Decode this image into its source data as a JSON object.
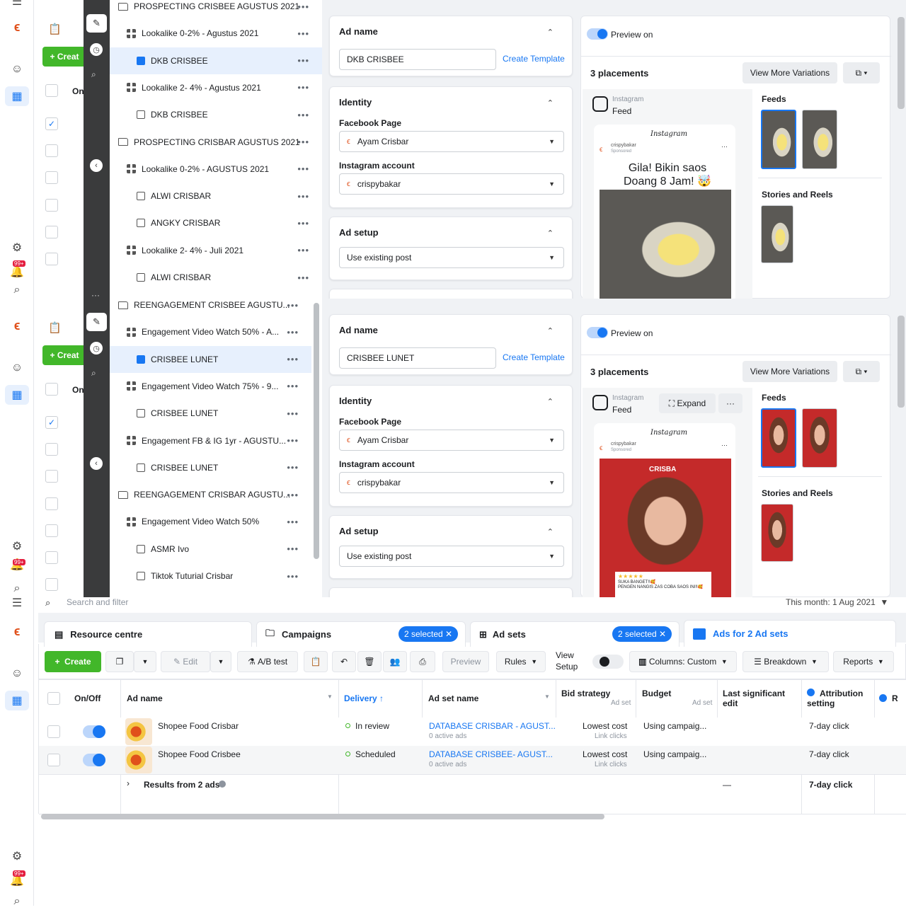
{
  "nav": {
    "badge": "99+"
  },
  "tree": {
    "top": [
      {
        "label": "PROSPECTING CRISBEE AGUSTUS 2021",
        "type": "campaign"
      },
      {
        "label": "Lookalike 0-2% - Agustus 2021",
        "type": "adset"
      },
      {
        "label": "DKB CRISBEE",
        "type": "ad-selected"
      },
      {
        "label": "Lookalike 2- 4% - Agustus 2021",
        "type": "adset"
      },
      {
        "label": "DKB CRISBEE",
        "type": "ad"
      },
      {
        "label": "PROSPECTING CRISBAR AGUSTUS 2021",
        "type": "campaign"
      },
      {
        "label": "Lookalike 0-2% - AGUSTUS 2021",
        "type": "adset"
      },
      {
        "label": "ALWI CRISBAR",
        "type": "ad"
      },
      {
        "label": "ANGKY CRISBAR",
        "type": "ad"
      },
      {
        "label": "Lookalike 2- 4% - Juli 2021",
        "type": "adset"
      },
      {
        "label": "ALWI CRISBAR",
        "type": "ad"
      }
    ],
    "bottom": [
      {
        "label": "REENGAGEMENT CRISBEE AGUSTU...",
        "type": "campaign"
      },
      {
        "label": "Engagement Video Watch 50% - A...",
        "type": "adset"
      },
      {
        "label": "CRISBEE LUNET",
        "type": "ad-selected"
      },
      {
        "label": "Engagement Video Watch 75% - 9...",
        "type": "adset"
      },
      {
        "label": "CRISBEE LUNET",
        "type": "ad"
      },
      {
        "label": "Engagement FB & IG 1yr - AGUSTU...",
        "type": "adset"
      },
      {
        "label": "CRISBEE LUNET",
        "type": "ad"
      },
      {
        "label": "REENGAGEMENT CRISBAR AGUSTU...",
        "type": "campaign"
      },
      {
        "label": "Engagement Video Watch 50%",
        "type": "adset"
      },
      {
        "label": "ASMR Ivo",
        "type": "ad"
      },
      {
        "label": "Tiktok Tuturial Crisbar",
        "type": "ad"
      }
    ]
  },
  "left": {
    "create": "Creat",
    "onoff": "On"
  },
  "editor_top": {
    "ad_name_title": "Ad name",
    "ad_name_value": "DKB CRISBEE",
    "create_template": "Create Template",
    "identity_title": "Identity",
    "facebook_page_label": "Facebook Page",
    "facebook_page_value": "Ayam Crisbar",
    "instagram_label": "Instagram account",
    "instagram_value": "crispybakar",
    "ad_setup_title": "Ad setup",
    "ad_setup_value": "Use existing post"
  },
  "editor_bottom": {
    "ad_name_title": "Ad name",
    "ad_name_value": "CRISBEE LUNET",
    "create_template": "Create Template",
    "identity_title": "Identity",
    "facebook_page_label": "Facebook Page",
    "facebook_page_value": "Ayam Crisbar",
    "instagram_label": "Instagram account",
    "instagram_value": "crispybakar",
    "ad_setup_title": "Ad setup",
    "ad_setup_value": "Use existing post"
  },
  "preview_top": {
    "preview_on": "Preview on",
    "placements": "3 placements",
    "view_more": "View More Variations",
    "platform": "Instagram",
    "placement": "Feed",
    "ig_brand": "Instagram",
    "account": "crispybakar",
    "sponsored": "Sponsored",
    "caption": "Gila! Bikin saos Doang 8 Jam! 🤯",
    "feeds": "Feeds",
    "stories": "Stories and Reels"
  },
  "preview_bottom": {
    "preview_on": "Preview on",
    "placements": "3 placements",
    "view_more": "View More Variations",
    "platform": "Instagram",
    "placement": "Feed",
    "expand": "Expand",
    "ig_brand": "Instagram",
    "account": "crispybakar",
    "sponsored": "Sponsored",
    "overlay_brand": "CRISBA",
    "comment": "SUKA BANGET!!🥰",
    "comment2": "PENGEN NANGIS ZAS COBA SAOS INI!!🥰",
    "stars": "★★★★★",
    "feeds": "Feeds",
    "stories": "Stories and Reels"
  },
  "manager": {
    "search_placeholder": "Search and filter",
    "date_range": "This month: 1 Aug 2021",
    "resource_centre": "Resource centre",
    "campaigns": "Campaigns",
    "campaigns_selected": "2 selected ✕",
    "adsets": "Ad sets",
    "adsets_selected": "2 selected ✕",
    "ads_tab": "Ads for 2 Ad sets",
    "toolbar": {
      "create": "Create",
      "edit": "Edit",
      "ab_test": "A/B test",
      "preview": "Preview",
      "rules": "Rules",
      "view_setup": "View Setup",
      "columns": "Columns: Custom",
      "breakdown": "Breakdown",
      "reports": "Reports"
    },
    "columns": {
      "onoff": "On/Off",
      "ad_name": "Ad name",
      "delivery": "Delivery ↑",
      "adset_name": "Ad set name",
      "bid": "Bid strategy",
      "bid_sub": "Ad set",
      "budget": "Budget",
      "budget_sub": "Ad set",
      "last_edit": "Last significant edit",
      "attribution": "Attribution setting",
      "r": "R"
    },
    "rows": [
      {
        "ad": "Shopee Food Crisbar",
        "delivery": "In review",
        "adset": "DATABASE CRISBAR - AGUST...",
        "adset_sub": "0 active ads",
        "bid": "Lowest cost",
        "bid_sub": "Link clicks",
        "budget": "Using campaig...",
        "attribution": "7-day click"
      },
      {
        "ad": "Shopee Food Crisbee",
        "delivery": "Scheduled",
        "adset": "DATABASE CRISBEE- AGUST...",
        "adset_sub": "0 active ads",
        "bid": "Lowest cost",
        "bid_sub": "Link clicks",
        "budget": "Using campaig...",
        "attribution": "7-day click"
      }
    ],
    "results": "Results from 2 ads",
    "results_edit": "—",
    "results_attr": "7-day click"
  }
}
